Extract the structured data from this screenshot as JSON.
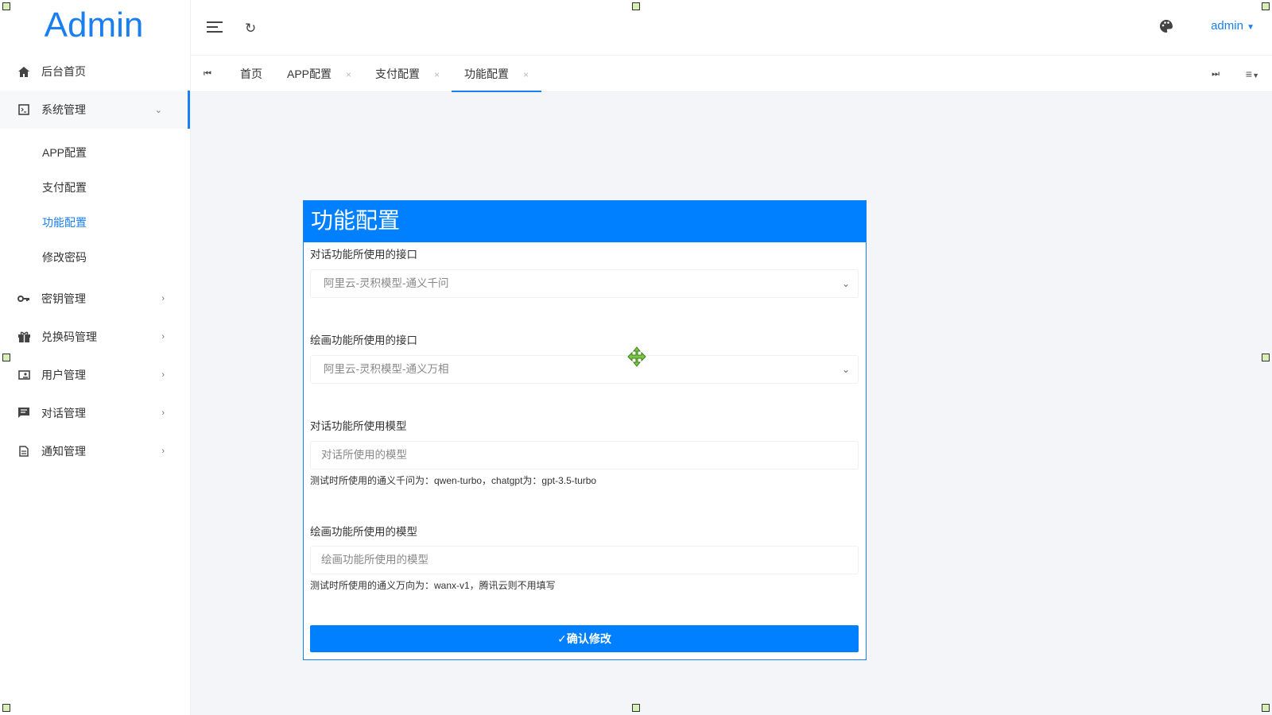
{
  "brand": "Admin",
  "header": {
    "user": "admin"
  },
  "sidebar": {
    "home": "后台首页",
    "system": "系统管理",
    "system_children": [
      "APP配置",
      "支付配置",
      "功能配置",
      "修改密码"
    ],
    "keys": "密钥管理",
    "redeem": "兑换码管理",
    "users": "用户管理",
    "chats": "对话管理",
    "notices": "通知管理"
  },
  "tabs": [
    {
      "label": "首页"
    },
    {
      "label": "APP配置",
      "close": "×"
    },
    {
      "label": "支付配置",
      "close": "×"
    },
    {
      "label": "功能配置",
      "close": "×"
    }
  ],
  "form": {
    "title": "功能配置",
    "chat_api_label": "对话功能所使用的接口",
    "chat_api_value": "阿里云-灵积模型-通义千问",
    "draw_api_label": "绘画功能所使用的接口",
    "draw_api_value": "阿里云-灵积模型-通义万相",
    "chat_model_label": "对话功能所使用模型",
    "chat_model_placeholder": "对话所使用的模型",
    "chat_model_help": "测试时所使用的通义千问为：qwen-turbo，chatgpt为：gpt-3.5-turbo",
    "draw_model_label": "绘画功能所使用的模型",
    "draw_model_placeholder": "绘画功能所使用的模型",
    "draw_model_help": "测试时所使用的通义万向为：wanx-v1，腾讯云则不用填写",
    "submit": "确认修改"
  },
  "colors": {
    "accent": "#0080ff"
  }
}
